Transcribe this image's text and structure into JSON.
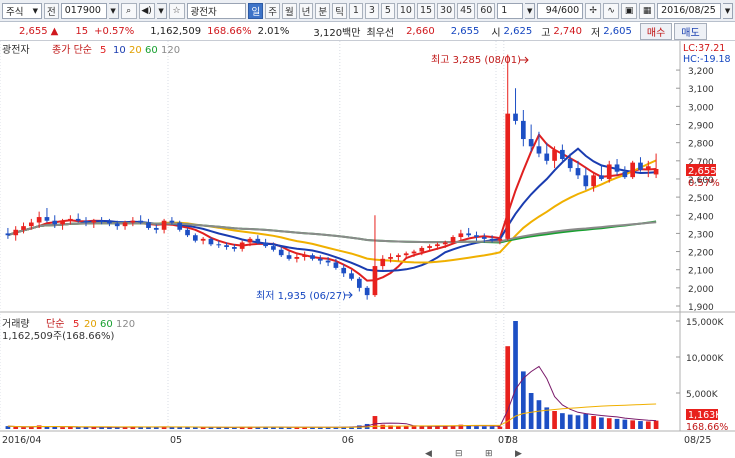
{
  "toolbar": {
    "market": "주식",
    "prefix": "전",
    "code": "017900",
    "name": "광전자",
    "periods": [
      "일",
      "주",
      "월",
      "년",
      "분",
      "틱"
    ],
    "intervals": [
      "1",
      "3",
      "5",
      "10",
      "15",
      "30",
      "45",
      "60"
    ],
    "interval_value": "1",
    "range": "94/600",
    "date": "2016/08/25"
  },
  "quote": {
    "price": "2,655",
    "arrow": "▲",
    "change": "15",
    "change_pct": "+0.57%",
    "volume": "1,162,509",
    "vol_ratio": "168.66%",
    "turnover": "2.01%",
    "amount": "3,120백만",
    "best_label": "최우선",
    "ask": "2,660",
    "bid": "2,655",
    "open_label": "시",
    "open": "2,625",
    "high_label": "고",
    "high": "2,740",
    "low_label": "저",
    "low": "2,605",
    "buy": "매수",
    "sell": "매도"
  },
  "price_panel": {
    "name": "광전자",
    "legend_type": "종가 단순",
    "ma": [
      "5",
      "10",
      "20",
      "60",
      "120"
    ],
    "lc": "LC:37.21",
    "hc": "HC:-19.18",
    "high_note": "최고 3,285 (08/01)",
    "low_note": "최저 1,935 (06/27)",
    "cur_tag": "2,655",
    "pct_tag": "0.57%",
    "y_ticks": [
      "3,200",
      "3,100",
      "3,000",
      "2,900",
      "2,800",
      "2,700",
      "2,600",
      "2,500",
      "2,400",
      "2,300",
      "2,200",
      "2,100",
      "2,000",
      "1,900"
    ]
  },
  "vol_panel": {
    "title": "거래량",
    "legend_type": "단순",
    "ma": [
      "5",
      "20",
      "60",
      "120"
    ],
    "value_label": "1,162,509주(168.66%)",
    "y_ticks": [
      "15,000K",
      "10,000K",
      "5,000K"
    ],
    "cur_tag": "1,163K",
    "pct_tag": "168.66%"
  },
  "x_ticks": [
    "2016/04",
    "05",
    "06",
    "07",
    "08",
    "08/25"
  ],
  "colors": {
    "up": "#e8211d",
    "down": "#1d4fc4",
    "ma5": "#e02020",
    "ma10": "#1a3cb0",
    "ma20": "#f0b000",
    "ma60": "#18a030",
    "ma120": "#8a8a8a"
  },
  "chart_data": {
    "type": "candlestick",
    "ylim": [
      1900,
      3250
    ],
    "vol_ylim": [
      0,
      15000
    ],
    "candles": [
      [
        2300,
        2330,
        2270,
        2290
      ],
      [
        2290,
        2340,
        2260,
        2320
      ],
      [
        2320,
        2360,
        2300,
        2340
      ],
      [
        2340,
        2380,
        2320,
        2360
      ],
      [
        2360,
        2420,
        2330,
        2390
      ],
      [
        2390,
        2440,
        2360,
        2370
      ],
      [
        2370,
        2400,
        2330,
        2350
      ],
      [
        2350,
        2380,
        2320,
        2370
      ],
      [
        2370,
        2400,
        2350,
        2380
      ],
      [
        2380,
        2410,
        2360,
        2370
      ],
      [
        2370,
        2390,
        2340,
        2360
      ],
      [
        2360,
        2380,
        2330,
        2370
      ],
      [
        2370,
        2390,
        2350,
        2365
      ],
      [
        2365,
        2380,
        2340,
        2355
      ],
      [
        2355,
        2370,
        2320,
        2340
      ],
      [
        2340,
        2370,
        2320,
        2360
      ],
      [
        2360,
        2390,
        2340,
        2370
      ],
      [
        2370,
        2400,
        2350,
        2360
      ],
      [
        2360,
        2380,
        2320,
        2330
      ],
      [
        2330,
        2350,
        2300,
        2320
      ],
      [
        2320,
        2380,
        2300,
        2370
      ],
      [
        2370,
        2390,
        2350,
        2360
      ],
      [
        2360,
        2370,
        2310,
        2320
      ],
      [
        2320,
        2330,
        2280,
        2290
      ],
      [
        2290,
        2300,
        2250,
        2260
      ],
      [
        2260,
        2280,
        2240,
        2270
      ],
      [
        2270,
        2280,
        2230,
        2240
      ],
      [
        2240,
        2260,
        2220,
        2235
      ],
      [
        2235,
        2250,
        2210,
        2225
      ],
      [
        2225,
        2240,
        2200,
        2215
      ],
      [
        2215,
        2260,
        2200,
        2250
      ],
      [
        2250,
        2280,
        2230,
        2270
      ],
      [
        2270,
        2290,
        2240,
        2250
      ],
      [
        2250,
        2270,
        2220,
        2230
      ],
      [
        2230,
        2250,
        2200,
        2210
      ],
      [
        2210,
        2230,
        2170,
        2180
      ],
      [
        2180,
        2200,
        2150,
        2160
      ],
      [
        2160,
        2190,
        2140,
        2170
      ],
      [
        2170,
        2200,
        2150,
        2180
      ],
      [
        2180,
        2190,
        2150,
        2160
      ],
      [
        2160,
        2180,
        2130,
        2150
      ],
      [
        2150,
        2170,
        2120,
        2140
      ],
      [
        2140,
        2160,
        2100,
        2110
      ],
      [
        2110,
        2130,
        2060,
        2080
      ],
      [
        2080,
        2100,
        2040,
        2050
      ],
      [
        2050,
        2060,
        1980,
        2000
      ],
      [
        2000,
        2010,
        1935,
        1960
      ],
      [
        1960,
        2400,
        1950,
        2120
      ],
      [
        2120,
        2180,
        2100,
        2160
      ],
      [
        2160,
        2190,
        2140,
        2170
      ],
      [
        2170,
        2190,
        2150,
        2180
      ],
      [
        2180,
        2200,
        2160,
        2190
      ],
      [
        2190,
        2210,
        2170,
        2200
      ],
      [
        2200,
        2230,
        2180,
        2220
      ],
      [
        2220,
        2240,
        2200,
        2230
      ],
      [
        2230,
        2250,
        2210,
        2240
      ],
      [
        2240,
        2260,
        2220,
        2250
      ],
      [
        2250,
        2290,
        2240,
        2280
      ],
      [
        2280,
        2320,
        2260,
        2300
      ],
      [
        2300,
        2330,
        2280,
        2290
      ],
      [
        2290,
        2310,
        2260,
        2280
      ],
      [
        2280,
        2300,
        2250,
        2270
      ],
      [
        2270,
        2290,
        2250,
        2260
      ],
      [
        2260,
        2280,
        2240,
        2270
      ],
      [
        2270,
        3285,
        2260,
        2960
      ],
      [
        2960,
        3100,
        2900,
        2920
      ],
      [
        2920,
        2980,
        2780,
        2820
      ],
      [
        2820,
        2900,
        2750,
        2780
      ],
      [
        2780,
        2860,
        2720,
        2740
      ],
      [
        2740,
        2800,
        2680,
        2700
      ],
      [
        2700,
        2780,
        2660,
        2760
      ],
      [
        2760,
        2790,
        2700,
        2710
      ],
      [
        2710,
        2740,
        2640,
        2660
      ],
      [
        2660,
        2700,
        2600,
        2620
      ],
      [
        2620,
        2660,
        2540,
        2560
      ],
      [
        2560,
        2640,
        2530,
        2620
      ],
      [
        2620,
        2680,
        2590,
        2600
      ],
      [
        2600,
        2700,
        2580,
        2680
      ],
      [
        2680,
        2710,
        2620,
        2640
      ],
      [
        2640,
        2670,
        2600,
        2610
      ],
      [
        2610,
        2700,
        2600,
        2690
      ],
      [
        2690,
        2720,
        2640,
        2650
      ],
      [
        2650,
        2700,
        2610,
        2670
      ],
      [
        2625,
        2740,
        2605,
        2655
      ]
    ],
    "volumes": [
      400,
      300,
      250,
      300,
      500,
      350,
      300,
      250,
      300,
      280,
      250,
      260,
      240,
      230,
      260,
      300,
      320,
      280,
      260,
      240,
      350,
      280,
      260,
      240,
      250,
      220,
      210,
      230,
      220,
      210,
      280,
      300,
      260,
      240,
      230,
      260,
      280,
      250,
      240,
      230,
      220,
      240,
      260,
      300,
      350,
      500,
      700,
      1800,
      600,
      500,
      400,
      380,
      360,
      400,
      420,
      380,
      360,
      500,
      600,
      450,
      380,
      360,
      340,
      330,
      11500,
      15000,
      8000,
      5000,
      4000,
      3000,
      2500,
      2200,
      2000,
      1900,
      2100,
      1800,
      1600,
      1500,
      1400,
      1300,
      1200,
      1100,
      1050,
      1163
    ]
  }
}
